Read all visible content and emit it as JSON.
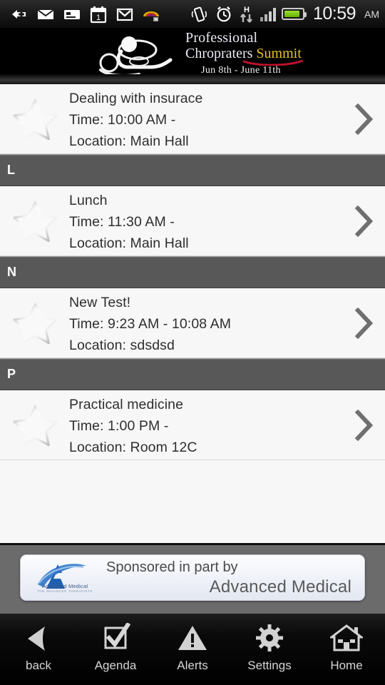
{
  "statusbar": {
    "time": "10:59",
    "ampm": "AM",
    "network_label": "H",
    "icons": [
      "back-arrow-icon",
      "mail-icon",
      "message-card-icon",
      "calendar-icon",
      "gmail-icon",
      "rss-icon",
      "vibrate-icon",
      "alarm-icon",
      "hspa-data-icon",
      "signal-bars-icon",
      "battery-icon"
    ]
  },
  "header": {
    "line1": "Professional",
    "line2_a": "Chropraters",
    "line2_b": "Summit",
    "dates": "Jun 8th - June 11th",
    "gold": "#e2c12a",
    "swoosh": "#c0122b"
  },
  "list": [
    {
      "type": "item",
      "title": "Dealing with insurace",
      "time": "Time: 10:00 AM -",
      "location": "Location: Main Hall"
    },
    {
      "type": "section",
      "letter": "L"
    },
    {
      "type": "item",
      "title": "Lunch",
      "time": "Time: 11:30 AM -",
      "location": "Location: Main Hall"
    },
    {
      "type": "section",
      "letter": "N"
    },
    {
      "type": "item",
      "title": "New Test!",
      "time": "Time: 9:23 AM - 10:08 AM",
      "location": "Location: sdsdsd"
    },
    {
      "type": "section",
      "letter": "P"
    },
    {
      "type": "item",
      "title": "Practical medicine",
      "time": "Time: 1:00 PM -",
      "location": "Location: Room 12C"
    }
  ],
  "ad": {
    "line1": "Sponsored in part by",
    "line2": "Advanced Medical",
    "logo_name": "Advanced Medical",
    "logo_tagline": "THE ADVANCED THERAPISTS"
  },
  "navbar": [
    {
      "label": "back",
      "icon": "back-triangle-icon"
    },
    {
      "label": "Agenda",
      "icon": "checkbox-check-icon"
    },
    {
      "label": "Alerts",
      "icon": "warning-triangle-icon"
    },
    {
      "label": "Settings",
      "icon": "gear-icon"
    },
    {
      "label": "Home",
      "icon": "house-icon"
    }
  ]
}
